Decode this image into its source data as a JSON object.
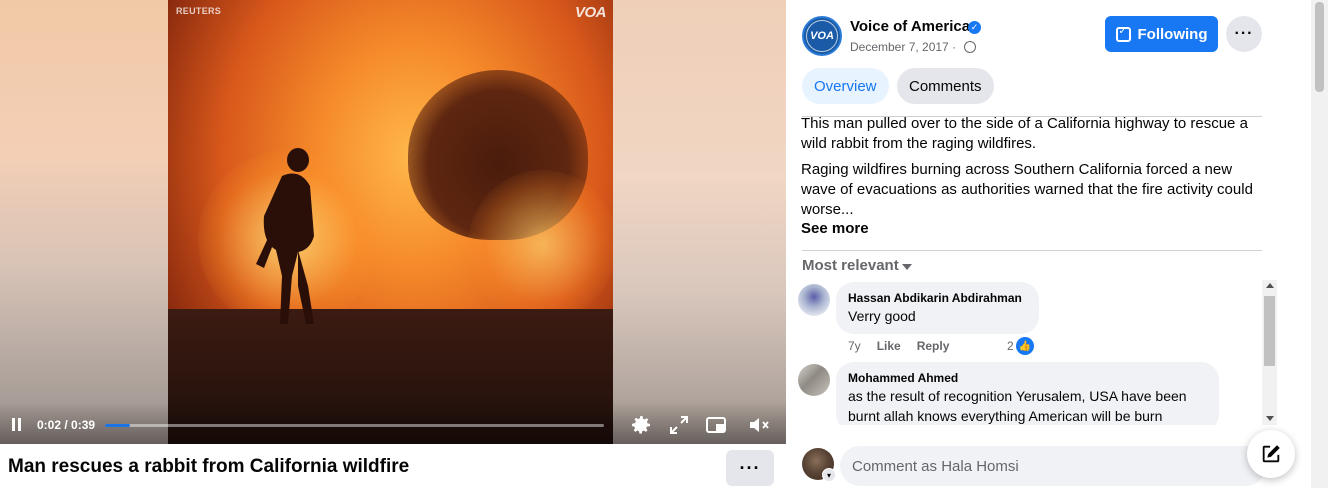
{
  "video": {
    "watermark": "REUTERS",
    "logo": "VOA",
    "time": "0:02 / 0:39",
    "progress": 0.051,
    "controls": [
      "pause-icon",
      "gear-icon",
      "fullscreen-icon",
      "pip-icon",
      "mute-icon"
    ]
  },
  "post": {
    "title": "Man rescues a rabbit from California wildfire",
    "more_label": "···"
  },
  "page": {
    "name": "Voice of America",
    "avatar_text": "VOA",
    "date": "December 7, 2017 ·",
    "follow_label": "Following",
    "more_label": "···"
  },
  "tabs": [
    {
      "label": "Overview"
    },
    {
      "label": "Comments"
    }
  ],
  "description": {
    "p1": "This man pulled over to the side of a California highway to rescue a wild rabbit from the raging wildfires.",
    "p2": "Raging wildfires burning across Southern California forced a new wave of evacuations as authorities warned that the fire activity could worse...",
    "see_more": "See more"
  },
  "comments_sort": "Most relevant",
  "comments": [
    {
      "name": "Hassan Abdikarin Abdirahman",
      "text": "Verry good",
      "age": "7y",
      "like": "Like",
      "reply": "Reply",
      "reactions": "2"
    },
    {
      "name": "Mohammed Ahmed",
      "text": "as the result of recognition Yerusalem, USA have been burnt allah knows everything American will be burn"
    }
  ],
  "composer": {
    "placeholder": "Comment as Hala Homsi"
  },
  "colors": {
    "accent": "#1877f2",
    "tab_active_bg": "#e7f3ff",
    "bubble_bg": "#f0f2f5"
  }
}
